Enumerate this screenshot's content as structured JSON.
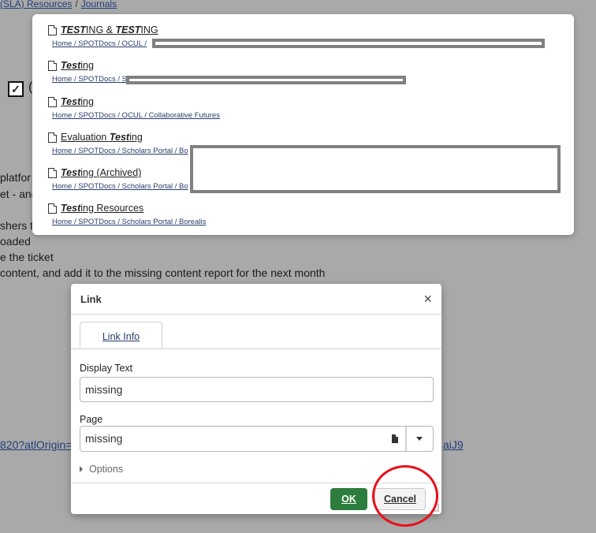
{
  "background": {
    "breadcrumb": [
      "(SLA) Resources",
      "Journals"
    ],
    "text_lines": [
      "platfor",
      "et - and",
      "shers t",
      "oaded",
      "e the ticket",
      "content, and add it to the missing content report for the next month"
    ],
    "link_left": "820?atlOrigin=e",
    "link_right": "aiJ9",
    "checkbox_mark": "✓",
    "letter": "("
  },
  "suggestions": [
    {
      "title_parts": [
        {
          "t": "TEST",
          "b": true
        },
        {
          "t": "ING & ",
          "b": false
        },
        {
          "t": "TEST",
          "b": true
        },
        {
          "t": "ING",
          "b": false
        }
      ],
      "path": "Home / SPOTDocs / OCUL /"
    },
    {
      "title_parts": [
        {
          "t": "Test",
          "b": true
        },
        {
          "t": "ing",
          "b": false
        }
      ],
      "path": "Home / SPOTDocs / S"
    },
    {
      "title_parts": [
        {
          "t": "Test",
          "b": true
        },
        {
          "t": "ing",
          "b": false
        }
      ],
      "path": "Home / SPOTDocs / OCUL / Collaborative Futures"
    },
    {
      "title_parts": [
        {
          "t": "Evaluation ",
          "b": false
        },
        {
          "t": "Test",
          "b": true
        },
        {
          "t": "ing",
          "b": false
        }
      ],
      "path": "Home / SPOTDocs / Scholars Portal / Bo"
    },
    {
      "title_parts": [
        {
          "t": "Test",
          "b": true
        },
        {
          "t": "ing (Archived)",
          "b": false
        }
      ],
      "path": "Home / SPOTDocs / Scholars Portal / Bo"
    },
    {
      "title_parts": [
        {
          "t": "Test",
          "b": true
        },
        {
          "t": "ing Resources",
          "b": false
        }
      ],
      "path": "Home / SPOTDocs / Scholars Portal / Borealis"
    }
  ],
  "dialog": {
    "title": "Link",
    "close": "×",
    "tab": "Link Info",
    "display_text_label": "Display Text",
    "display_text_value": "missing",
    "page_label": "Page",
    "page_value": "missing",
    "options_label": "Options",
    "ok_label": "OK",
    "cancel_label": "Cancel"
  },
  "colors": {
    "ok_button": "#2d7d3e",
    "annotation_circle": "#e8101a",
    "overlay": "#a9a9a9"
  }
}
